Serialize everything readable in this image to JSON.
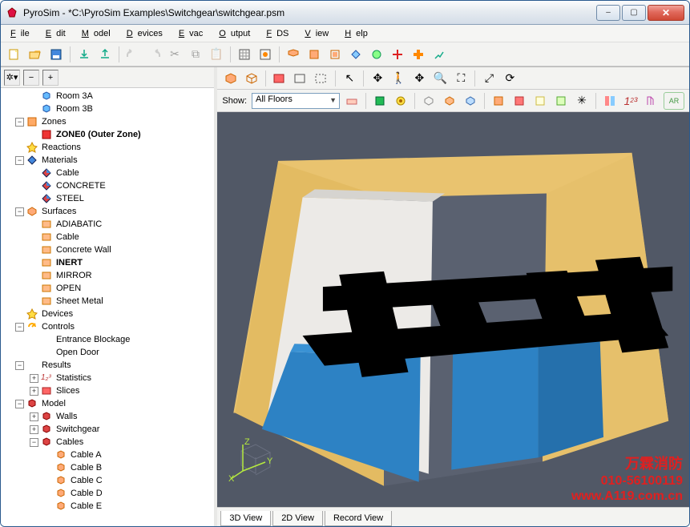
{
  "window": {
    "title": "PyroSim - *C:\\PyroSim Examples\\Switchgear\\switchgear.psm"
  },
  "winbtns": {
    "min": "–",
    "max": "▢",
    "close": "✕"
  },
  "menu": [
    "File",
    "Edit",
    "Model",
    "Devices",
    "Evac",
    "Output",
    "FDS",
    "View",
    "Help"
  ],
  "left": {
    "buttons": [
      "gear",
      "minus",
      "plus"
    ]
  },
  "show": {
    "label": "Show:",
    "value": "All Floors"
  },
  "tabs": {
    "active": "3D View",
    "items": [
      "3D View",
      "2D View",
      "Record View"
    ]
  },
  "axis": {
    "x": "X",
    "y": "Y",
    "z": "Z"
  },
  "tree": [
    {
      "d": 2,
      "icon": "cube-blue",
      "label": "Room 3A",
      "exp": ""
    },
    {
      "d": 2,
      "icon": "cube-blue",
      "label": "Room 3B",
      "exp": ""
    },
    {
      "d": 1,
      "icon": "zone",
      "label": "Zones",
      "exp": "-"
    },
    {
      "d": 2,
      "icon": "zone-red",
      "label": "ZONE0 (Outer Zone)",
      "bold": true,
      "exp": ""
    },
    {
      "d": 1,
      "icon": "react",
      "label": "Reactions",
      "exp": ""
    },
    {
      "d": 1,
      "icon": "mat",
      "label": "Materials",
      "exp": "-"
    },
    {
      "d": 2,
      "icon": "mat2",
      "label": "Cable",
      "exp": ""
    },
    {
      "d": 2,
      "icon": "mat2",
      "label": "CONCRETE",
      "exp": ""
    },
    {
      "d": 2,
      "icon": "mat2",
      "label": "STEEL",
      "exp": ""
    },
    {
      "d": 1,
      "icon": "surf",
      "label": "Surfaces",
      "exp": "-"
    },
    {
      "d": 2,
      "icon": "surf2",
      "label": "ADIABATIC",
      "exp": ""
    },
    {
      "d": 2,
      "icon": "surf2",
      "label": "Cable",
      "exp": ""
    },
    {
      "d": 2,
      "icon": "surf2",
      "label": "Concrete Wall",
      "exp": ""
    },
    {
      "d": 2,
      "icon": "surf2",
      "label": "INERT",
      "bold": true,
      "exp": ""
    },
    {
      "d": 2,
      "icon": "surf2",
      "label": "MIRROR",
      "exp": ""
    },
    {
      "d": 2,
      "icon": "surf2",
      "label": "OPEN",
      "exp": ""
    },
    {
      "d": 2,
      "icon": "surf2",
      "label": "Sheet Metal",
      "exp": ""
    },
    {
      "d": 1,
      "icon": "dev",
      "label": "Devices",
      "exp": ""
    },
    {
      "d": 1,
      "icon": "ctrl",
      "label": "Controls",
      "exp": "-"
    },
    {
      "d": 2,
      "icon": "blank",
      "label": "Entrance Blockage",
      "exp": ""
    },
    {
      "d": 2,
      "icon": "blank",
      "label": "Open Door",
      "exp": ""
    },
    {
      "d": 1,
      "icon": "res",
      "label": "Results",
      "exp": "-"
    },
    {
      "d": 2,
      "icon": "stat",
      "label": "Statistics",
      "exp": "+"
    },
    {
      "d": 2,
      "icon": "slice",
      "label": "Slices",
      "exp": "+"
    },
    {
      "d": 1,
      "icon": "model",
      "label": "Model",
      "exp": "-"
    },
    {
      "d": 2,
      "icon": "grp",
      "label": "Walls",
      "exp": "+"
    },
    {
      "d": 2,
      "icon": "grp",
      "label": "Switchgear",
      "exp": "+"
    },
    {
      "d": 2,
      "icon": "grp",
      "label": "Cables",
      "exp": "-"
    },
    {
      "d": 3,
      "icon": "obj",
      "label": "Cable A",
      "exp": ""
    },
    {
      "d": 3,
      "icon": "obj",
      "label": "Cable B",
      "exp": ""
    },
    {
      "d": 3,
      "icon": "obj",
      "label": "Cable C",
      "exp": ""
    },
    {
      "d": 3,
      "icon": "obj",
      "label": "Cable D",
      "exp": ""
    },
    {
      "d": 3,
      "icon": "obj",
      "label": "Cable E",
      "exp": ""
    }
  ],
  "watermark": {
    "l1": "万霖消防",
    "l2": "010-56100119",
    "l3": "www.A119.com.cn"
  }
}
